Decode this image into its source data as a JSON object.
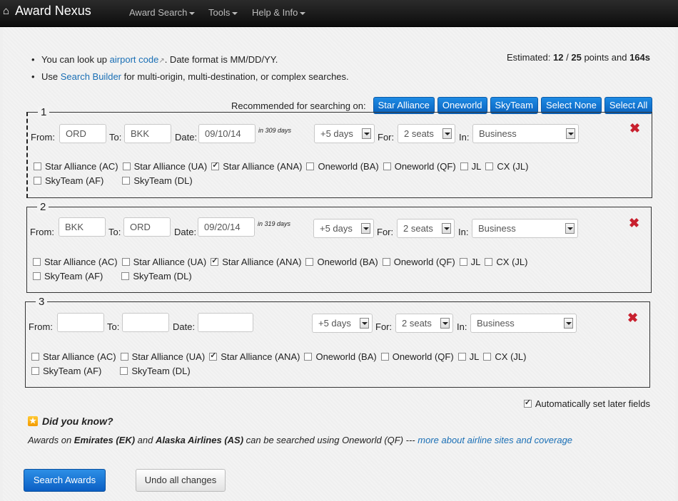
{
  "nav": {
    "brand": "Award Nexus",
    "menus": [
      "Award Search",
      "Tools",
      "Help & Info"
    ]
  },
  "info": {
    "line1_pre": "You can look up ",
    "line1_link": "airport code",
    "line1_post": ". Date format is MM/DD/YY.",
    "line2_pre": "Use ",
    "line2_link": "Search Builder",
    "line2_post": " for multi-origin, multi-destination, or complex searches."
  },
  "estimated": {
    "label": "Estimated:",
    "used": "12",
    "sep": "/",
    "total": "25",
    "points_label": "points and",
    "time": "164s"
  },
  "recommend": {
    "label": "Recommended for searching on:",
    "buttons": [
      "Star Alliance",
      "Oneworld",
      "SkyTeam",
      "Select None",
      "Select All"
    ]
  },
  "labels": {
    "from": "From:",
    "to": "To:",
    "date": "Date:",
    "for": "For:",
    "in": "In:"
  },
  "segments": [
    {
      "num": "1",
      "from": "ORD",
      "to": "BKK",
      "date": "09/10/14",
      "days_note": "in 309 days",
      "flex": "+5 days",
      "seats": "2 seats",
      "cabin": "Business",
      "checks": [
        {
          "label": "Star Alliance (AC)",
          "on": false
        },
        {
          "label": "Star Alliance (UA)",
          "on": false
        },
        {
          "label": "Star Alliance (ANA)",
          "on": true
        },
        {
          "label": "Oneworld (BA)",
          "on": false
        },
        {
          "label": "Oneworld (QF)",
          "on": false
        },
        {
          "label": "JL",
          "on": false
        },
        {
          "label": "CX (JL)",
          "on": false
        },
        {
          "label": "SkyTeam (AF)",
          "on": false
        },
        {
          "label": "SkyTeam (DL)",
          "on": false
        }
      ]
    },
    {
      "num": "2",
      "from": "BKK",
      "to": "ORD",
      "date": "09/20/14",
      "days_note": "in 319 days",
      "flex": "+5 days",
      "seats": "2 seats",
      "cabin": "Business",
      "checks": [
        {
          "label": "Star Alliance (AC)",
          "on": false
        },
        {
          "label": "Star Alliance (UA)",
          "on": false
        },
        {
          "label": "Star Alliance (ANA)",
          "on": true
        },
        {
          "label": "Oneworld (BA)",
          "on": false
        },
        {
          "label": "Oneworld (QF)",
          "on": false
        },
        {
          "label": "JL",
          "on": false
        },
        {
          "label": "CX (JL)",
          "on": false
        },
        {
          "label": "SkyTeam (AF)",
          "on": false
        },
        {
          "label": "SkyTeam (DL)",
          "on": false
        }
      ]
    },
    {
      "num": "3",
      "from": "",
      "to": "",
      "date": "",
      "days_note": "",
      "flex": "+5 days",
      "seats": "2 seats",
      "cabin": "Business",
      "checks": [
        {
          "label": "Star Alliance (AC)",
          "on": false
        },
        {
          "label": "Star Alliance (UA)",
          "on": false
        },
        {
          "label": "Star Alliance (ANA)",
          "on": true
        },
        {
          "label": "Oneworld (BA)",
          "on": false
        },
        {
          "label": "Oneworld (QF)",
          "on": false
        },
        {
          "label": "JL",
          "on": false
        },
        {
          "label": "CX (JL)",
          "on": false
        },
        {
          "label": "SkyTeam (AF)",
          "on": false
        },
        {
          "label": "SkyTeam (DL)",
          "on": false
        }
      ]
    }
  ],
  "auto_set": {
    "label": "Automatically set later fields",
    "on": true
  },
  "did_you_know": {
    "title": "Did you know?",
    "t1": "Awards on ",
    "b1": "Emirates (EK)",
    "t2": " and ",
    "b2": "Alaska Airlines (AS)",
    "t3": " can be searched using Oneworld (QF) --- ",
    "link": "more about airline sites and coverage"
  },
  "actions": {
    "search": "Search Awards",
    "undo": "Undo all changes"
  }
}
